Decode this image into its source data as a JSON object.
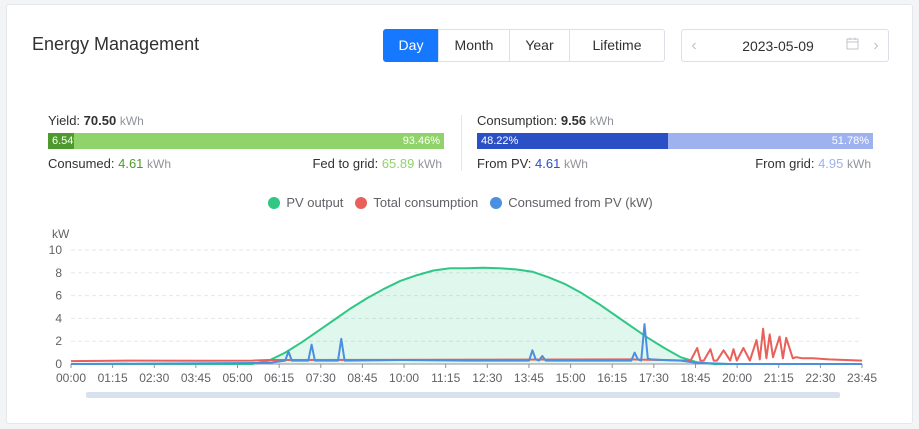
{
  "header": {
    "title": "Energy Management"
  },
  "period_tabs": [
    {
      "label": "Day",
      "active": true
    },
    {
      "label": "Month",
      "active": false
    },
    {
      "label": "Year",
      "active": false
    },
    {
      "label": "Lifetime",
      "active": false
    }
  ],
  "date_picker": {
    "value": "2023-05-09",
    "prev_icon": "chevron-left-icon",
    "next_icon": "chevron-right-icon",
    "calendar_icon": "calendar-icon"
  },
  "yield": {
    "label": "Yield:",
    "value": "70.50",
    "unit": "kWh",
    "bar_left_pct": "6.54%",
    "bar_right_pct": "93.46%",
    "bar_left_fraction": 0.0654,
    "consumed_label": "Consumed:",
    "consumed_value": "4.61",
    "consumed_unit": "kWh",
    "fed_label": "Fed to grid:",
    "fed_value": "65.89",
    "fed_unit": "kWh"
  },
  "consumption": {
    "label": "Consumption:",
    "value": "9.56",
    "unit": "kWh",
    "bar_left_pct": "48.22%",
    "bar_right_pct": "51.78%",
    "bar_left_fraction": 0.4822,
    "from_pv_label": "From PV:",
    "from_pv_value": "4.61",
    "from_pv_unit": "kWh",
    "from_grid_label": "From grid:",
    "from_grid_value": "4.95",
    "from_grid_unit": "kWh"
  },
  "colors": {
    "accent": "#1677ff",
    "yield_dark": "#4f9a2e",
    "yield_light": "#8fd36a",
    "cons_dark": "#2b4fc4",
    "cons_light": "#9fb2f0",
    "pv": "#2ec784",
    "total": "#e8605a",
    "consumed": "#4a8fe0"
  },
  "chart_data": {
    "type": "line",
    "ylabel": "kW",
    "ylim": [
      0,
      10
    ],
    "yticks": [
      "0",
      "2",
      "4",
      "6",
      "8",
      "10"
    ],
    "xticks": [
      "00:00",
      "01:15",
      "02:30",
      "03:45",
      "05:00",
      "06:15",
      "07:30",
      "08:45",
      "10:00",
      "11:15",
      "12:30",
      "13:45",
      "15:00",
      "16:15",
      "17:30",
      "18:45",
      "20:00",
      "21:15",
      "22:30",
      "23:45"
    ],
    "grid": true,
    "legend_position": "top-center",
    "series": [
      {
        "name": "PV output",
        "x_hours": [
          0,
          5.5,
          6.0,
          6.5,
          7.0,
          7.5,
          8.0,
          8.5,
          9.0,
          9.5,
          10.0,
          10.5,
          11.0,
          11.5,
          12.0,
          12.5,
          13.0,
          13.5,
          14.0,
          14.5,
          15.0,
          15.5,
          16.0,
          16.5,
          17.0,
          17.5,
          18.0,
          18.5,
          19.0,
          19.5,
          20.0,
          24.0
        ],
        "values": [
          0,
          0,
          0.3,
          1.0,
          1.9,
          2.9,
          3.9,
          4.9,
          5.8,
          6.6,
          7.3,
          7.8,
          8.2,
          8.4,
          8.4,
          8.45,
          8.4,
          8.3,
          8.1,
          7.6,
          7.0,
          6.2,
          5.3,
          4.3,
          3.3,
          2.3,
          1.4,
          0.6,
          0.15,
          0.0,
          0,
          0
        ]
      },
      {
        "name": "Total consumption",
        "x_hours": [
          0,
          2.0,
          4.0,
          5.5,
          6.0,
          17.0,
          18.8,
          19.0,
          19.1,
          19.2,
          19.4,
          19.5,
          19.6,
          19.8,
          20.0,
          20.1,
          20.2,
          20.4,
          20.6,
          20.8,
          20.9,
          21.0,
          21.1,
          21.2,
          21.3,
          21.5,
          21.6,
          21.7,
          21.9,
          22.0,
          22.2,
          22.5,
          23.0,
          23.5,
          24.0
        ],
        "values": [
          0.25,
          0.3,
          0.28,
          0.3,
          0.35,
          0.4,
          0.3,
          1.4,
          0.3,
          0.3,
          1.3,
          0.3,
          0.3,
          1.2,
          0.3,
          1.3,
          0.3,
          1.4,
          0.3,
          2.1,
          0.4,
          3.1,
          0.5,
          2.6,
          0.6,
          2.4,
          0.5,
          2.3,
          0.5,
          0.6,
          0.5,
          0.5,
          0.4,
          0.35,
          0.3
        ]
      },
      {
        "name": "Consumed from PV (kW)",
        "x_hours": [
          0,
          6.0,
          6.5,
          6.6,
          6.7,
          7.2,
          7.3,
          7.4,
          8.1,
          8.2,
          8.3,
          10.0,
          12.0,
          13.9,
          14.0,
          14.1,
          14.2,
          14.3,
          14.4,
          17.0,
          17.1,
          17.2,
          17.3,
          17.4,
          17.5,
          17.6,
          18.0,
          18.5,
          19.0,
          19.5,
          20.0,
          24.0
        ],
        "values": [
          0,
          0.1,
          0.3,
          1.1,
          0.3,
          0.3,
          1.7,
          0.3,
          0.3,
          2.2,
          0.3,
          0.35,
          0.3,
          0.3,
          1.2,
          0.4,
          0.3,
          0.7,
          0.3,
          0.3,
          1.0,
          0.4,
          0.3,
          3.5,
          0.5,
          0.4,
          0.35,
          0.3,
          0.1,
          0.05,
          0,
          0
        ]
      }
    ]
  }
}
